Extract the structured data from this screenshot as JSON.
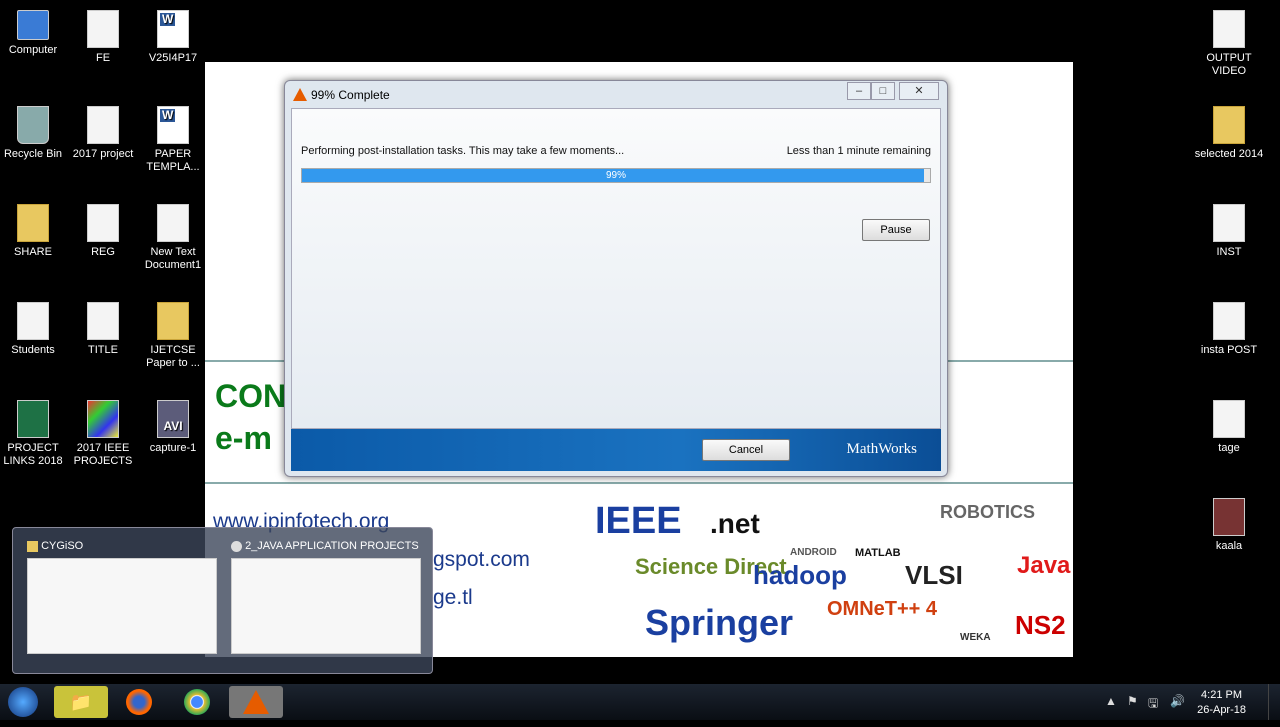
{
  "desktop": {
    "left": [
      {
        "label": "Computer",
        "type": "pc"
      },
      {
        "label": "FE",
        "type": "doc"
      },
      {
        "label": "V25I4P17",
        "type": "word"
      },
      {
        "label": "Recycle Bin",
        "type": "bin"
      },
      {
        "label": "2017 project",
        "type": "doc"
      },
      {
        "label": "PAPER TEMPLA...",
        "type": "word"
      },
      {
        "label": "SHARE",
        "type": "folder"
      },
      {
        "label": "REG",
        "type": "doc"
      },
      {
        "label": "New Text Document1",
        "type": "doc"
      },
      {
        "label": "Students",
        "type": "doc"
      },
      {
        "label": "TITLE",
        "type": "doc"
      },
      {
        "label": "IJETCSE Paper to ...",
        "type": "folder"
      },
      {
        "label": "PROJECT LINKS 2018",
        "type": "xls"
      },
      {
        "label": "2017 IEEE PROJECTS",
        "type": "multi"
      },
      {
        "label": "capture-1",
        "type": "avi"
      }
    ],
    "right": [
      {
        "label": "OUTPUT VIDEO",
        "type": "doc"
      },
      {
        "label": "selected 2014",
        "type": "folder"
      },
      {
        "label": "INST",
        "type": "doc"
      },
      {
        "label": "insta POST",
        "type": "doc"
      },
      {
        "label": "tage",
        "type": "doc"
      },
      {
        "label": "kaala",
        "type": "img"
      }
    ]
  },
  "background": {
    "text1": "CON",
    "text2": "e-m",
    "url1": "www.ipinfotech.org",
    "url2": "gspot.com",
    "url3": "ge.tl",
    "logos": [
      "IEEE",
      ".net",
      "ANDROID",
      "MATLAB",
      "ROBOTICS",
      "Java",
      "Science Direct",
      "hadoop",
      "VLSI",
      "Springer",
      "OMNeT++ 4",
      "WEKA",
      "NS2"
    ]
  },
  "dialog": {
    "title": "99% Complete",
    "status": "Performing post-installation tasks.  This may take a few moments...",
    "remaining": "Less than 1 minute remaining",
    "progress": 99,
    "progress_label": "99%",
    "pause": "Pause",
    "cancel": "Cancel",
    "brand": "MathWorks",
    "accent": "#3399ee"
  },
  "preview": {
    "items": [
      {
        "label": "CYGiSO"
      },
      {
        "label": "2_JAVA APPLICATION PROJECTS"
      }
    ]
  },
  "taskbar": {
    "time": "4:21 PM",
    "date": "26-Apr-18"
  }
}
